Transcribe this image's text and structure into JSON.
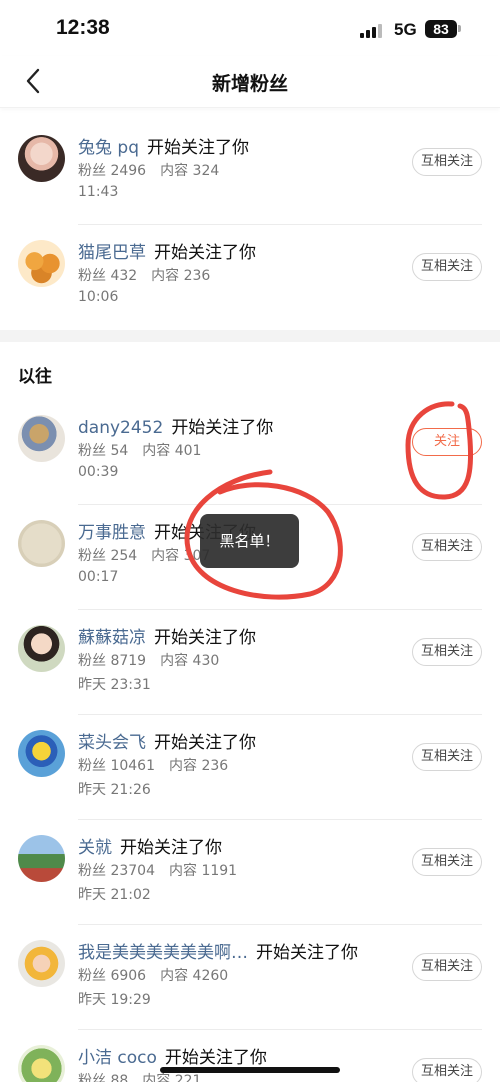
{
  "status_bar": {
    "time": "12:38",
    "network": "5G",
    "battery": "83"
  },
  "nav": {
    "title": "新增粉丝"
  },
  "recent": [
    {
      "name": "兔兔 pq",
      "action": "开始关注了你",
      "fans": "粉丝 2496",
      "content": "内容 324",
      "time": "11:43",
      "button": "互相关注"
    },
    {
      "name": "猫尾巴草",
      "action": "开始关注了你",
      "fans": "粉丝 432",
      "content": "内容 236",
      "time": "10:06",
      "button": "互相关注"
    }
  ],
  "past_section_title": "以往",
  "past": [
    {
      "name": "dany2452",
      "action": "开始关注了你",
      "fans": "粉丝 54",
      "content": "内容 401",
      "time": "00:39",
      "button": "关注",
      "style": "follow"
    },
    {
      "name": "万事胜意",
      "action": "开始关注了你",
      "fans": "粉丝 254",
      "content": "内容 307",
      "time": "00:17",
      "button": "互相关注"
    },
    {
      "name": "蘇蘇菇凉",
      "action": "开始关注了你",
      "fans": "粉丝 8719",
      "content": "内容 430",
      "time": "昨天  23:31",
      "button": "互相关注"
    },
    {
      "name": "菜头会飞",
      "action": "开始关注了你",
      "fans": "粉丝 10461",
      "content": "内容 236",
      "time": "昨天  21:26",
      "button": "互相关注"
    },
    {
      "name": "关就",
      "action": "开始关注了你",
      "fans": "粉丝 23704",
      "content": "内容 1191",
      "time": "昨天  21:02",
      "button": "互相关注"
    },
    {
      "name": "我是美美美美美美啊…",
      "action": "开始关注了你",
      "fans": "粉丝 6906",
      "content": "内容 4260",
      "time": "昨天  19:29",
      "button": "互相关注"
    },
    {
      "name": "小洁 coco",
      "action": "开始关注了你",
      "fans": "粉丝 88",
      "content": "内容 221",
      "time": "",
      "button": "互相关注"
    }
  ],
  "toast": {
    "text": "黑名单！"
  },
  "colors": {
    "username": "#4a6a91",
    "follow_accent": "#f26b4a",
    "annotation": "#e8453c"
  }
}
